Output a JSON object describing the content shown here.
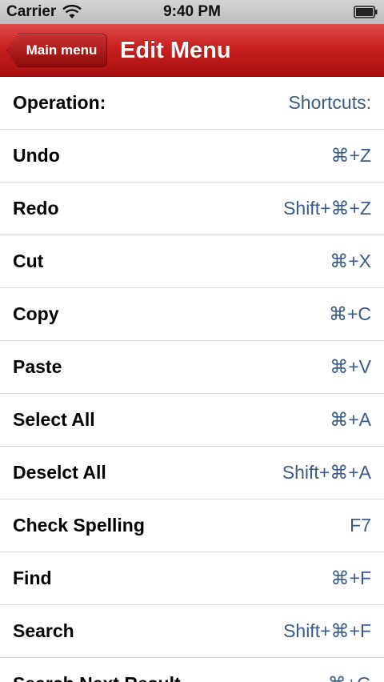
{
  "status_bar": {
    "carrier": "Carrier",
    "time": "9:40 PM",
    "wifi_icon": "wifi-icon",
    "battery_icon": "battery-icon"
  },
  "nav": {
    "back_label": "Main menu",
    "title": "Edit Menu",
    "color": "#c92020"
  },
  "table": {
    "header": {
      "operation": "Operation:",
      "shortcut": "Shortcuts:"
    },
    "rows": [
      {
        "operation": "Undo",
        "shortcut": "⌘+Z"
      },
      {
        "operation": "Redo",
        "shortcut": "Shift+⌘+Z"
      },
      {
        "operation": "Cut",
        "shortcut": "⌘+X"
      },
      {
        "operation": "Copy",
        "shortcut": "⌘+C"
      },
      {
        "operation": "Paste",
        "shortcut": "⌘+V"
      },
      {
        "operation": "Select All",
        "shortcut": "⌘+A"
      },
      {
        "operation": "Deselct All",
        "shortcut": "Shift+⌘+A"
      },
      {
        "operation": "Check Spelling",
        "shortcut": "F7"
      },
      {
        "operation": "Find",
        "shortcut": "⌘+F"
      },
      {
        "operation": "Search",
        "shortcut": "Shift+⌘+F"
      },
      {
        "operation": "Search Next Result",
        "shortcut": "⌘+G"
      }
    ]
  }
}
